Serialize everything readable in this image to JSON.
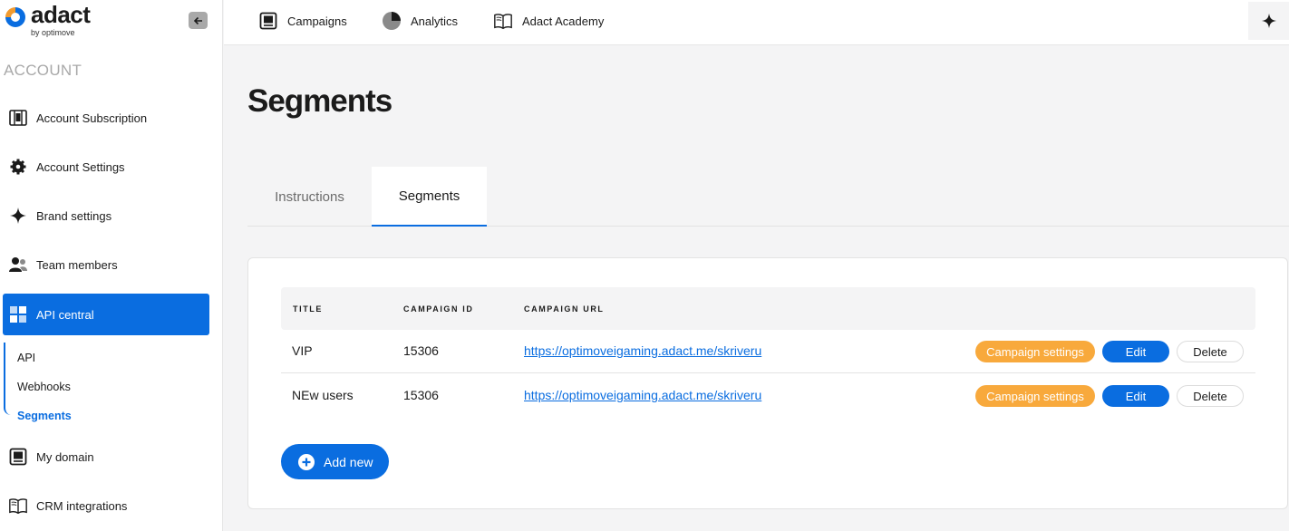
{
  "brand": {
    "name": "adact",
    "byline": "by optimove"
  },
  "sidebar": {
    "section_title": "ACCOUNT",
    "items": [
      {
        "label": "Account Subscription",
        "icon": "subscription-icon"
      },
      {
        "label": "Account Settings",
        "icon": "gear-icon"
      },
      {
        "label": "Brand settings",
        "icon": "sparkle-icon"
      },
      {
        "label": "Team members",
        "icon": "team-icon"
      },
      {
        "label": "API central",
        "icon": "grid-icon",
        "active": true
      },
      {
        "label": "My domain",
        "icon": "domain-icon"
      },
      {
        "label": "CRM integrations",
        "icon": "book-icon"
      }
    ],
    "subitems": [
      {
        "label": "API"
      },
      {
        "label": "Webhooks"
      },
      {
        "label": "Segments",
        "active": true
      }
    ]
  },
  "topbar": {
    "tabs": [
      {
        "label": "Campaigns",
        "icon": "campaigns-icon"
      },
      {
        "label": "Analytics",
        "icon": "pie-chart-icon"
      },
      {
        "label": "Adact Academy",
        "icon": "book-icon"
      }
    ]
  },
  "page": {
    "title": "Segments",
    "tabs": [
      {
        "label": "Instructions"
      },
      {
        "label": "Segments",
        "active": true
      }
    ]
  },
  "table": {
    "headers": [
      "TITLE",
      "CAMPAIGN ID",
      "CAMPAIGN URL"
    ],
    "rows": [
      {
        "title": "VIP",
        "campaign_id": "15306",
        "campaign_url": "https://optimoveigaming.adact.me/skriveru"
      },
      {
        "title": "NEw users",
        "campaign_id": "15306",
        "campaign_url": "https://optimoveigaming.adact.me/skriveru"
      }
    ],
    "actions": {
      "settings": "Campaign settings",
      "edit": "Edit",
      "delete": "Delete"
    }
  },
  "add_button": {
    "label": "Add new"
  },
  "colors": {
    "primary": "#0a6de0",
    "orange": "#f8a93c",
    "muted": "#a9a9a9"
  }
}
